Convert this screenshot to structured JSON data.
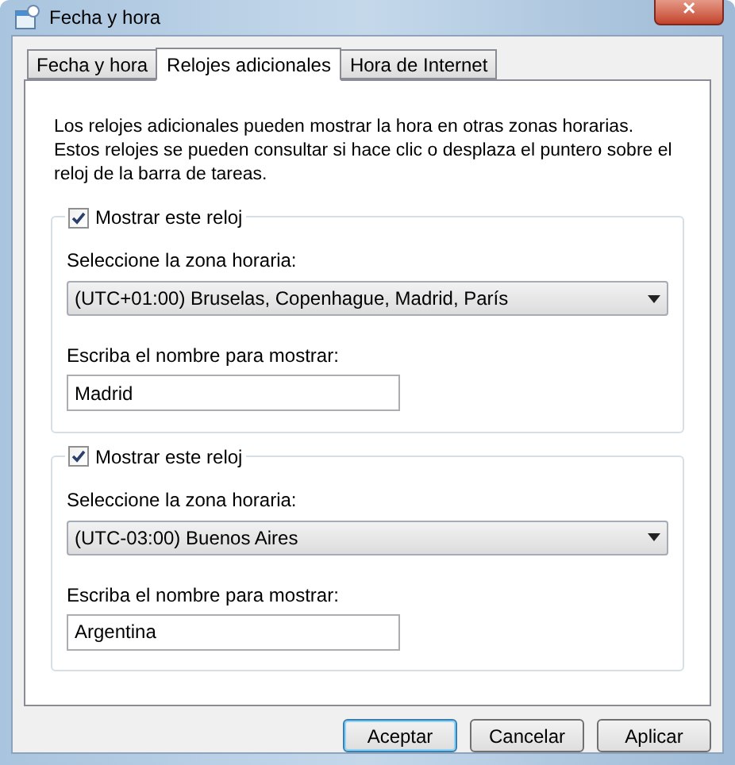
{
  "window": {
    "title": "Fecha y hora",
    "close": "✕"
  },
  "tabs": [
    {
      "label": "Fecha y hora",
      "selected": false
    },
    {
      "label": "Relojes adicionales",
      "selected": true
    },
    {
      "label": "Hora de Internet",
      "selected": false
    }
  ],
  "description": "Los relojes adicionales pueden mostrar la hora en otras zonas horarias. Estos relojes se pueden consultar si hace clic o desplaza el puntero sobre el reloj de la barra de tareas.",
  "clocks": [
    {
      "show_label": "Mostrar este reloj",
      "checked": true,
      "zone_label": "Seleccione la zona horaria:",
      "zone": "(UTC+01:00) Bruselas, Copenhague, Madrid, París",
      "name_label": "Escriba el nombre para mostrar:",
      "name": "Madrid"
    },
    {
      "show_label": "Mostrar este reloj",
      "checked": true,
      "zone_label": "Seleccione la zona horaria:",
      "zone": "(UTC-03:00) Buenos Aires",
      "name_label": "Escriba el nombre para mostrar:",
      "name": "Argentina"
    }
  ],
  "buttons": [
    {
      "label": "Aceptar",
      "default": true
    },
    {
      "label": "Cancelar",
      "default": false
    },
    {
      "label": "Aplicar",
      "default": false
    }
  ]
}
